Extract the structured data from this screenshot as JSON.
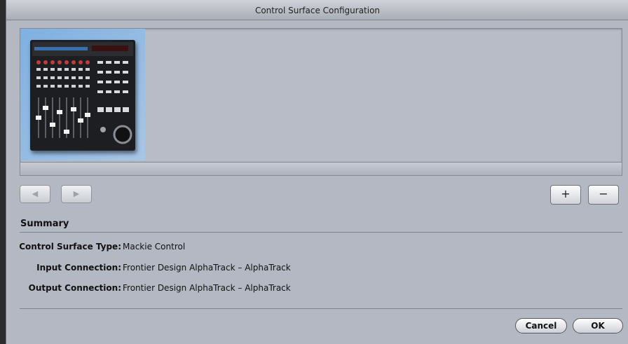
{
  "window": {
    "title": "Control Surface Configuration"
  },
  "navigation": {
    "prev_glyph": "◀",
    "next_glyph": "▶",
    "add_glyph": "+",
    "remove_glyph": "−"
  },
  "summary": {
    "title": "Summary",
    "rows": [
      {
        "label": "Control Surface Type:",
        "value": "Mackie Control"
      },
      {
        "label": "Input Connection:",
        "value": "Frontier Design AlphaTrack – AlphaTrack"
      },
      {
        "label": "Output Connection:",
        "value": "Frontier Design AlphaTrack – AlphaTrack"
      }
    ]
  },
  "buttons": {
    "cancel": "Cancel",
    "ok": "OK"
  },
  "colors": {
    "selection_blue": "#8fb8e4",
    "panel": "#b4b8c2"
  }
}
